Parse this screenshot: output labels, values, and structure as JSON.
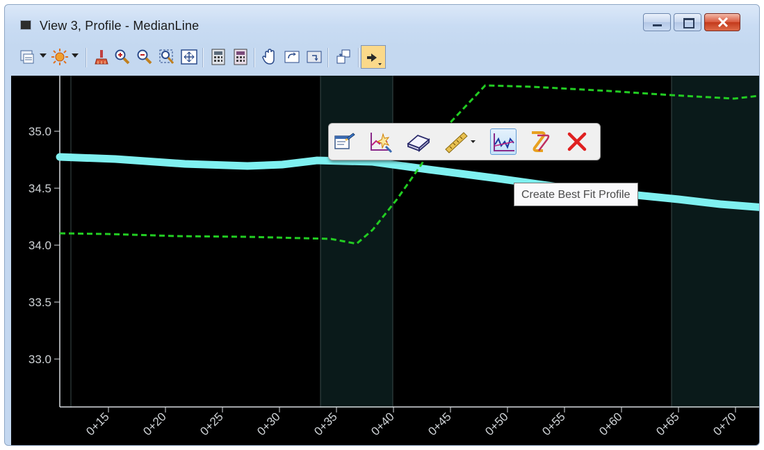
{
  "window": {
    "title": "View 3, Profile - MedianLine",
    "buttons": {
      "minimize": "minimize",
      "maximize": "maximize",
      "close": "close"
    }
  },
  "toolbar": {
    "icons": [
      "view-attributes-icon",
      "display-style-icon",
      "update-view-icon",
      "zoom-in-icon",
      "zoom-out-icon",
      "window-area-icon",
      "fit-view-icon",
      "view-previous-icon",
      "view-next-icon",
      "pan-view-icon",
      "rotate-view-icon",
      "view-settings-icon",
      "copy-view-icon",
      "profile-tools-icon"
    ]
  },
  "plot": {
    "y_ticks": [
      "35.0",
      "34.5",
      "34.0",
      "33.5",
      "33.0"
    ],
    "x_ticks": [
      "0+15",
      "0+20",
      "0+25",
      "0+30",
      "0+35",
      "0+40",
      "0+45",
      "0+50",
      "0+55",
      "0+60",
      "0+65",
      "0+70"
    ],
    "colors": {
      "background": "#000000",
      "existing_profile": "#7ff0f0",
      "proposed_profile": "#22cc22",
      "grid": "#3a4a4a"
    }
  },
  "floating_toolbar": {
    "items": [
      {
        "icon": "profile-properties-icon",
        "selected": false
      },
      {
        "icon": "profile-from-surface-icon",
        "selected": false
      },
      {
        "icon": "profile-eraser-icon",
        "selected": false
      },
      {
        "icon": "profile-measure-icon",
        "selected": false
      },
      {
        "icon": "best-fit-profile-icon",
        "selected": true
      },
      {
        "icon": "profile-link-icon",
        "selected": false
      },
      {
        "icon": "close-red-x-icon",
        "selected": false
      }
    ]
  },
  "tooltip": {
    "text": "Create Best Fit Profile"
  }
}
